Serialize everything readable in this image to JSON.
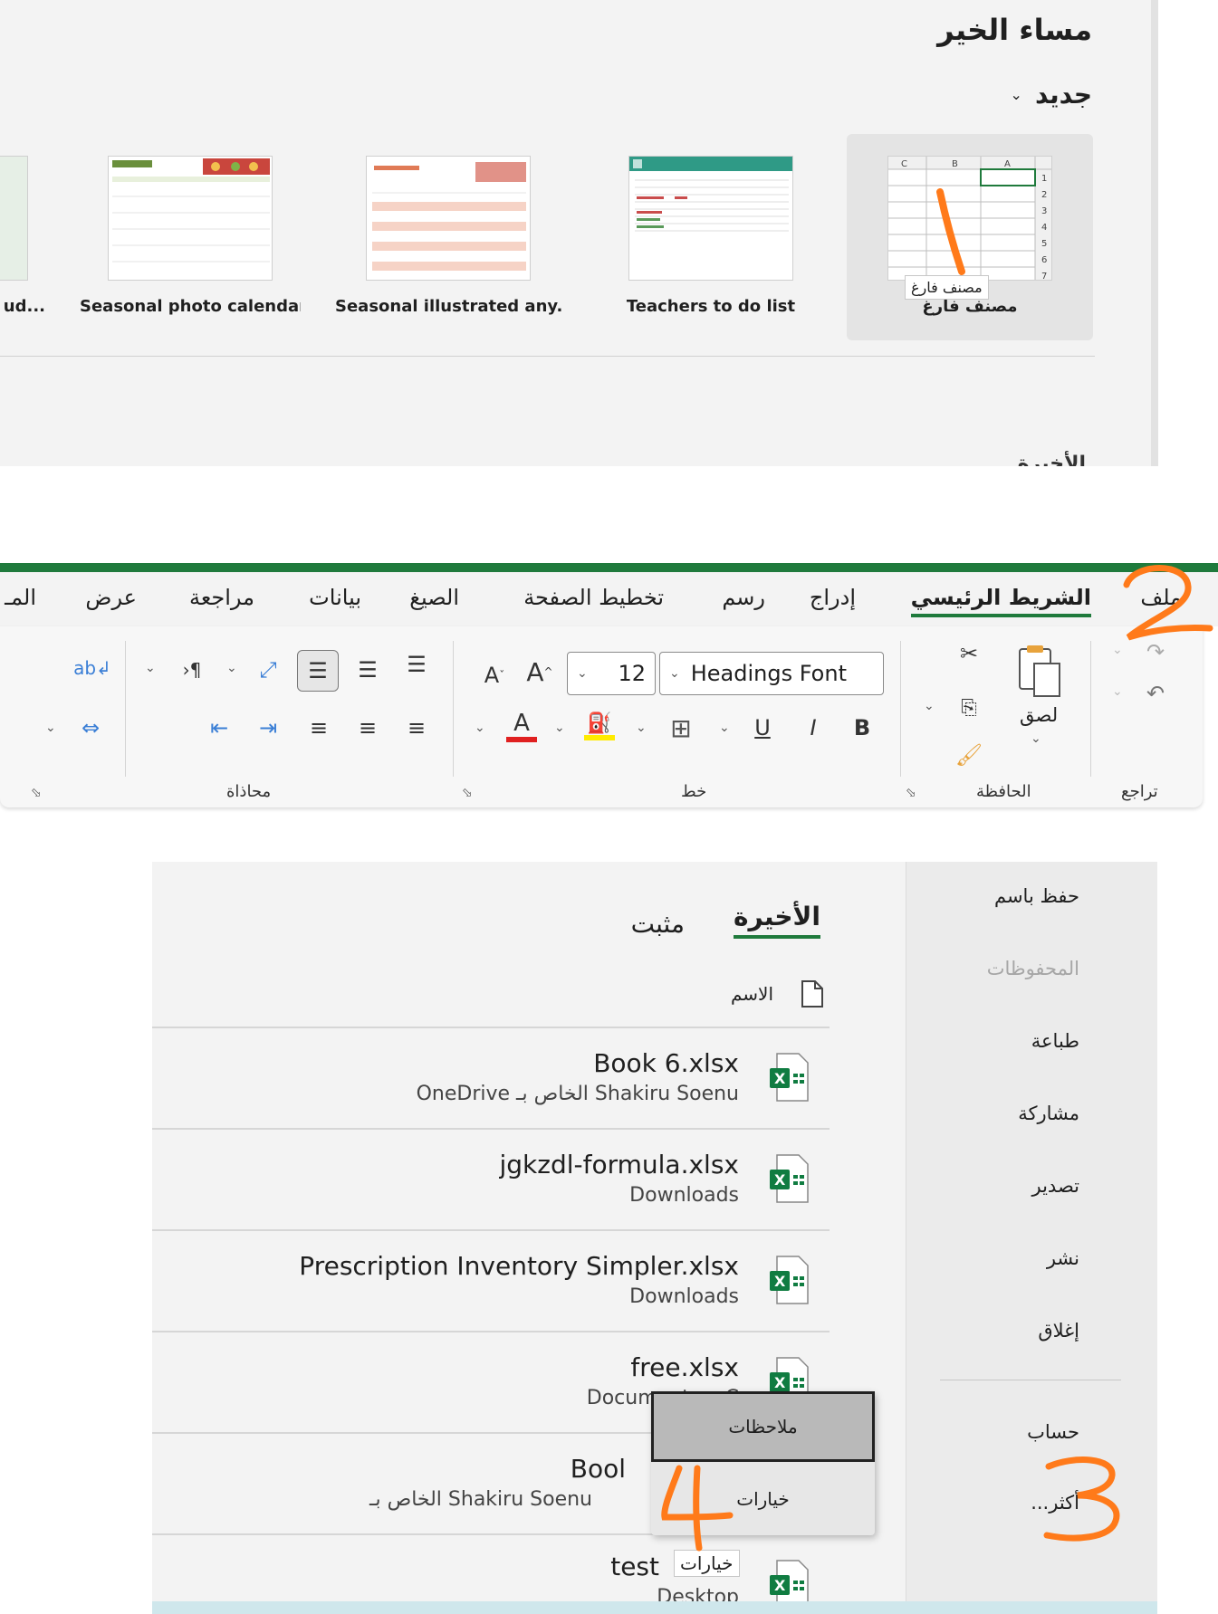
{
  "start": {
    "greeting": "مساء الخير",
    "new_label": "جديد",
    "templates": [
      {
        "name": "مصنف فارغ"
      },
      {
        "name": "Teachers to do list"
      },
      {
        "name": "Seasonal illustrated any..."
      },
      {
        "name": "Seasonal photo calendar"
      },
      {
        "name": "ud..."
      }
    ],
    "blank_tooltip": "مصنف فارغ",
    "recent_peek": "الأخيرة"
  },
  "ribbon": {
    "tabs": [
      "ملف",
      "الشريط الرئيسي",
      "إدراج",
      "رسم",
      "تخطيط الصفحة",
      "الصيغ",
      "بيانات",
      "مراجعة",
      "عرض",
      "المـ"
    ],
    "active_tab": "الشريط الرئيسي",
    "groups": {
      "undo": "تراجع",
      "clipboard": "الحافظة",
      "font": "خط",
      "alignment": "محاذاة"
    },
    "paste_label": "لصق",
    "font_name": "Headings Font",
    "font_size": "12",
    "accent_color": "#1f7a3c"
  },
  "backstage": {
    "nav": [
      "حفظ باسم",
      "المحفوظات",
      "طباعة",
      "مشاركة",
      "تصدير",
      "نشر",
      "إغلاق",
      "حساب",
      "أكثر..."
    ],
    "tabs": [
      "الأخيرة",
      "مثبت"
    ],
    "name_header": "الاسم",
    "files": [
      {
        "name": "Book 6.xlsx",
        "location": "OneDrive الخاص بـ Shakiru Soenu"
      },
      {
        "name": "jgkzdl-formula.xlsx",
        "location": "Downloads"
      },
      {
        "name": "Prescription Inventory Simpler.xlsx",
        "location": "Downloads"
      },
      {
        "name": "free.xlsx",
        "location": "Documents « C"
      },
      {
        "name": "Bool",
        "location": "الخاص بـ Shakiru Soenu"
      },
      {
        "name": "test",
        "location": "Desktop"
      }
    ],
    "context_menu": [
      "ملاحظات",
      "خيارات"
    ],
    "options_tooltip": "خيارات"
  },
  "annotations": {
    "numbers": [
      "١",
      "2",
      "3",
      "4"
    ],
    "color": "#ff7a1a"
  }
}
